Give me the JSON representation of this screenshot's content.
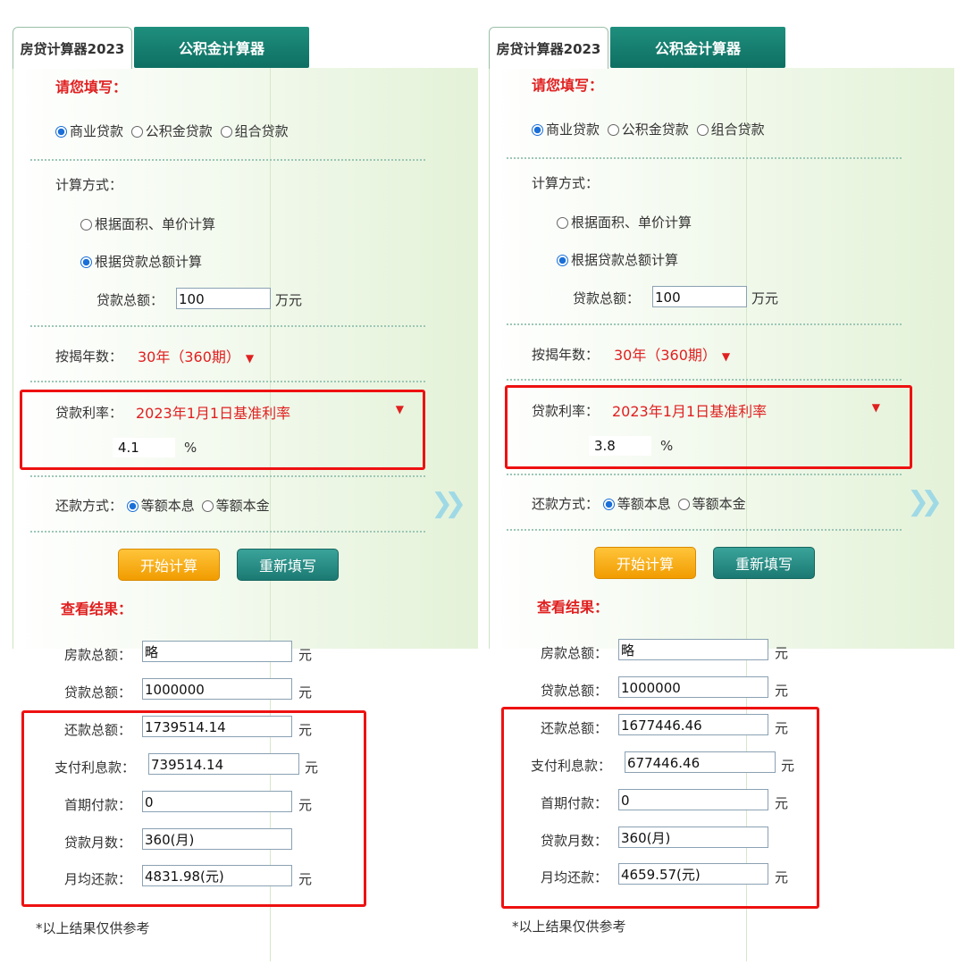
{
  "panels": [
    {
      "tabs": {
        "active": "房贷计算器2023",
        "inactive": "公积金计算器"
      },
      "fill_title": "请您填写：",
      "loan_types": {
        "commercial": "商业贷款",
        "fund": "公积金贷款",
        "combo": "组合贷款"
      },
      "calc_method_label": "计算方式：",
      "calc_by_area": "根据面积、单价计算",
      "calc_by_total": "根据贷款总额计算",
      "loan_total_label": "贷款总额：",
      "loan_total_value": "100",
      "loan_total_unit": "万元",
      "years_label": "按揭年数：",
      "years_value": "30年（360期）",
      "rate_label": "贷款利率：",
      "rate_select": "2023年1月1日基准利率",
      "rate_value": "4.1",
      "rate_unit": "%",
      "repay_label": "还款方式：",
      "repay_equal_installment": "等额本息",
      "repay_equal_principal": "等额本金",
      "btn_start": "开始计算",
      "btn_reset": "重新填写",
      "result_title": "查看结果：",
      "results": {
        "house_total_label": "房款总额：",
        "house_total_value": "略",
        "loan_total_label": "贷款总额：",
        "loan_total_value": "1000000",
        "repay_total_label": "还款总额：",
        "repay_total_value": "1739514.14",
        "interest_label": "支付利息款：",
        "interest_value": "739514.14",
        "first_pay_label": "首期付款：",
        "first_pay_value": "0",
        "months_label": "贷款月数：",
        "months_value": "360(月)",
        "monthly_label": "月均还款：",
        "monthly_value": "4831.98(元)",
        "unit": "元"
      },
      "footnote": "*以上结果仅供参考"
    },
    {
      "tabs": {
        "active": "房贷计算器2023",
        "inactive": "公积金计算器"
      },
      "fill_title": "请您填写：",
      "loan_types": {
        "commercial": "商业贷款",
        "fund": "公积金贷款",
        "combo": "组合贷款"
      },
      "calc_method_label": "计算方式：",
      "calc_by_area": "根据面积、单价计算",
      "calc_by_total": "根据贷款总额计算",
      "loan_total_label": "贷款总额：",
      "loan_total_value": "100",
      "loan_total_unit": "万元",
      "years_label": "按揭年数：",
      "years_value": "30年（360期）",
      "rate_label": "贷款利率：",
      "rate_select": "2023年1月1日基准利率",
      "rate_value": "3.8",
      "rate_unit": "%",
      "repay_label": "还款方式：",
      "repay_equal_installment": "等额本息",
      "repay_equal_principal": "等额本金",
      "btn_start": "开始计算",
      "btn_reset": "重新填写",
      "result_title": "查看结果：",
      "results": {
        "house_total_label": "房款总额：",
        "house_total_value": "略",
        "loan_total_label": "贷款总额：",
        "loan_total_value": "1000000",
        "repay_total_label": "还款总额：",
        "repay_total_value": "1677446.46",
        "interest_label": "支付利息款：",
        "interest_value": "677446.46",
        "first_pay_label": "首期付款：",
        "first_pay_value": "0",
        "months_label": "贷款月数：",
        "months_value": "360(月)",
        "monthly_label": "月均还款：",
        "monthly_value": "4659.57(元)",
        "unit": "元"
      },
      "footnote": "*以上结果仅供参考"
    }
  ]
}
